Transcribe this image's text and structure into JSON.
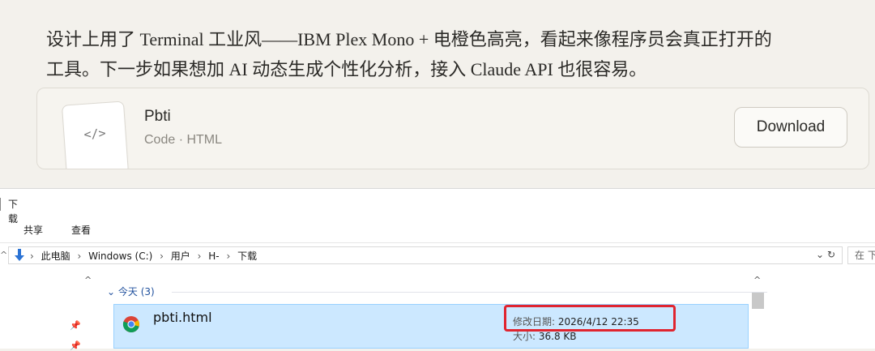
{
  "chat": {
    "line1": "设计上用了 Terminal 工业风——IBM Plex Mono + 电橙色高亮，看起来像程序员会真正打开的",
    "line2": "工具。下一步如果想加 AI 动态生成个性化分析，接入 Claude API 也很容易。",
    "artifact": {
      "icon_glyph": "</>",
      "title": "Pbti",
      "subtitle": "Code · HTML",
      "download_label": "Download"
    }
  },
  "explorer": {
    "window_title": "下载",
    "ribbon_tabs": [
      "共享",
      "查看"
    ],
    "address": {
      "crumbs": [
        "此电脑",
        "Windows (C:)",
        "用户",
        "H-",
        "下载"
      ],
      "search_placeholder": "在 下"
    },
    "group": {
      "label": "今天 (3)"
    },
    "selected_file": {
      "name": "pbti.html",
      "modified_label": "修改日期:",
      "modified_value": "2026/4/12 22:35",
      "size_label": "大小:",
      "size_value": "36.8 KB"
    },
    "colors": {
      "selection": "#cce8ff",
      "highlight_box": "#e0242f"
    }
  }
}
